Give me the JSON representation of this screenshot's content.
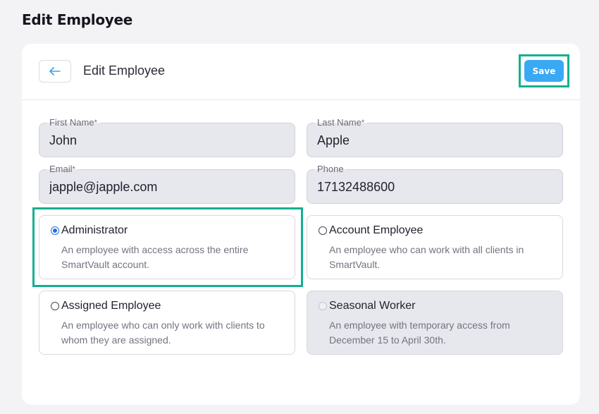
{
  "page": {
    "title": "Edit Employee"
  },
  "header": {
    "title": "Edit Employee",
    "save_label": "Save"
  },
  "form": {
    "first_name": {
      "label": "First Name",
      "required_mark": "*",
      "value": "John"
    },
    "last_name": {
      "label": "Last Name",
      "required_mark": "*",
      "value": "Apple"
    },
    "email": {
      "label": "Email",
      "required_mark": "*",
      "value": "japple@japple.com"
    },
    "phone": {
      "label": "Phone",
      "value": "17132488600"
    }
  },
  "roles": [
    {
      "title": "Administrator",
      "description": "An employee with access across the entire SmartVault account.",
      "selected": true,
      "disabled": false
    },
    {
      "title": "Account Employee",
      "description": "An employee who can work with all clients in SmartVault.",
      "selected": false,
      "disabled": false
    },
    {
      "title": "Assigned Employee",
      "description": "An employee who can only work with clients to whom they are assigned.",
      "selected": false,
      "disabled": false
    },
    {
      "title": "Seasonal Worker",
      "description": "An employee with temporary access from December 15 to April 30th.",
      "selected": false,
      "disabled": true
    }
  ],
  "colors": {
    "accent": "#3aa9f4",
    "highlight": "#12b18f",
    "radio_selected": "#1f6fe0"
  },
  "icons": {
    "back": "arrow-left-icon"
  }
}
